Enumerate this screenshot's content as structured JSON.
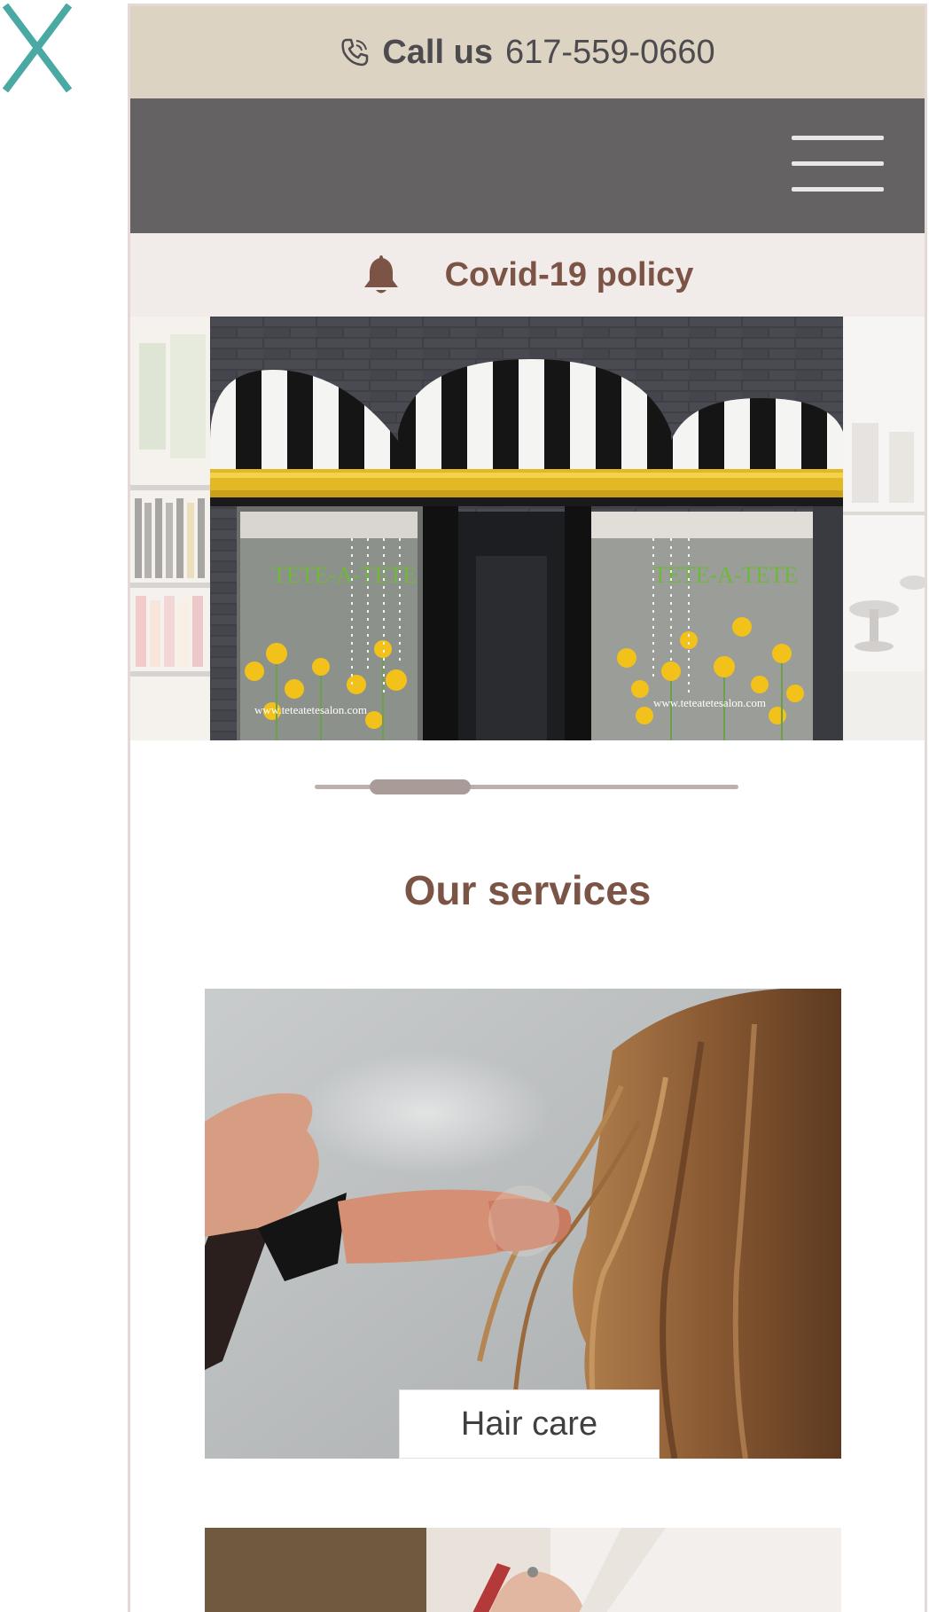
{
  "close_icon": "close-x-icon",
  "header": {
    "call_label": "Call us",
    "phone_number": "617-559-0660",
    "phone_icon": "phone-icon"
  },
  "nav": {
    "menu_icon": "hamburger-menu-icon"
  },
  "covid": {
    "label": "Covid-19 policy",
    "icon": "bell-icon"
  },
  "hero_carousel": {
    "storefront_sign_left": "TETE-A-TETE",
    "storefront_sign_right": "TETE-A-TETE",
    "storefront_url_left": "www.teteatetesalon.com",
    "storefront_url_right": "www.teteatetesalon.com",
    "slider_position_fraction": 0.17
  },
  "services": {
    "title": "Our services",
    "items": [
      {
        "label": "Hair care"
      }
    ]
  },
  "colors": {
    "call_bar": "#ddd3c3",
    "nav_bar": "#656263",
    "covid_bar": "#f1ebea",
    "accent_brown": "#7c5446",
    "close_icon": "#4aa9a2"
  }
}
